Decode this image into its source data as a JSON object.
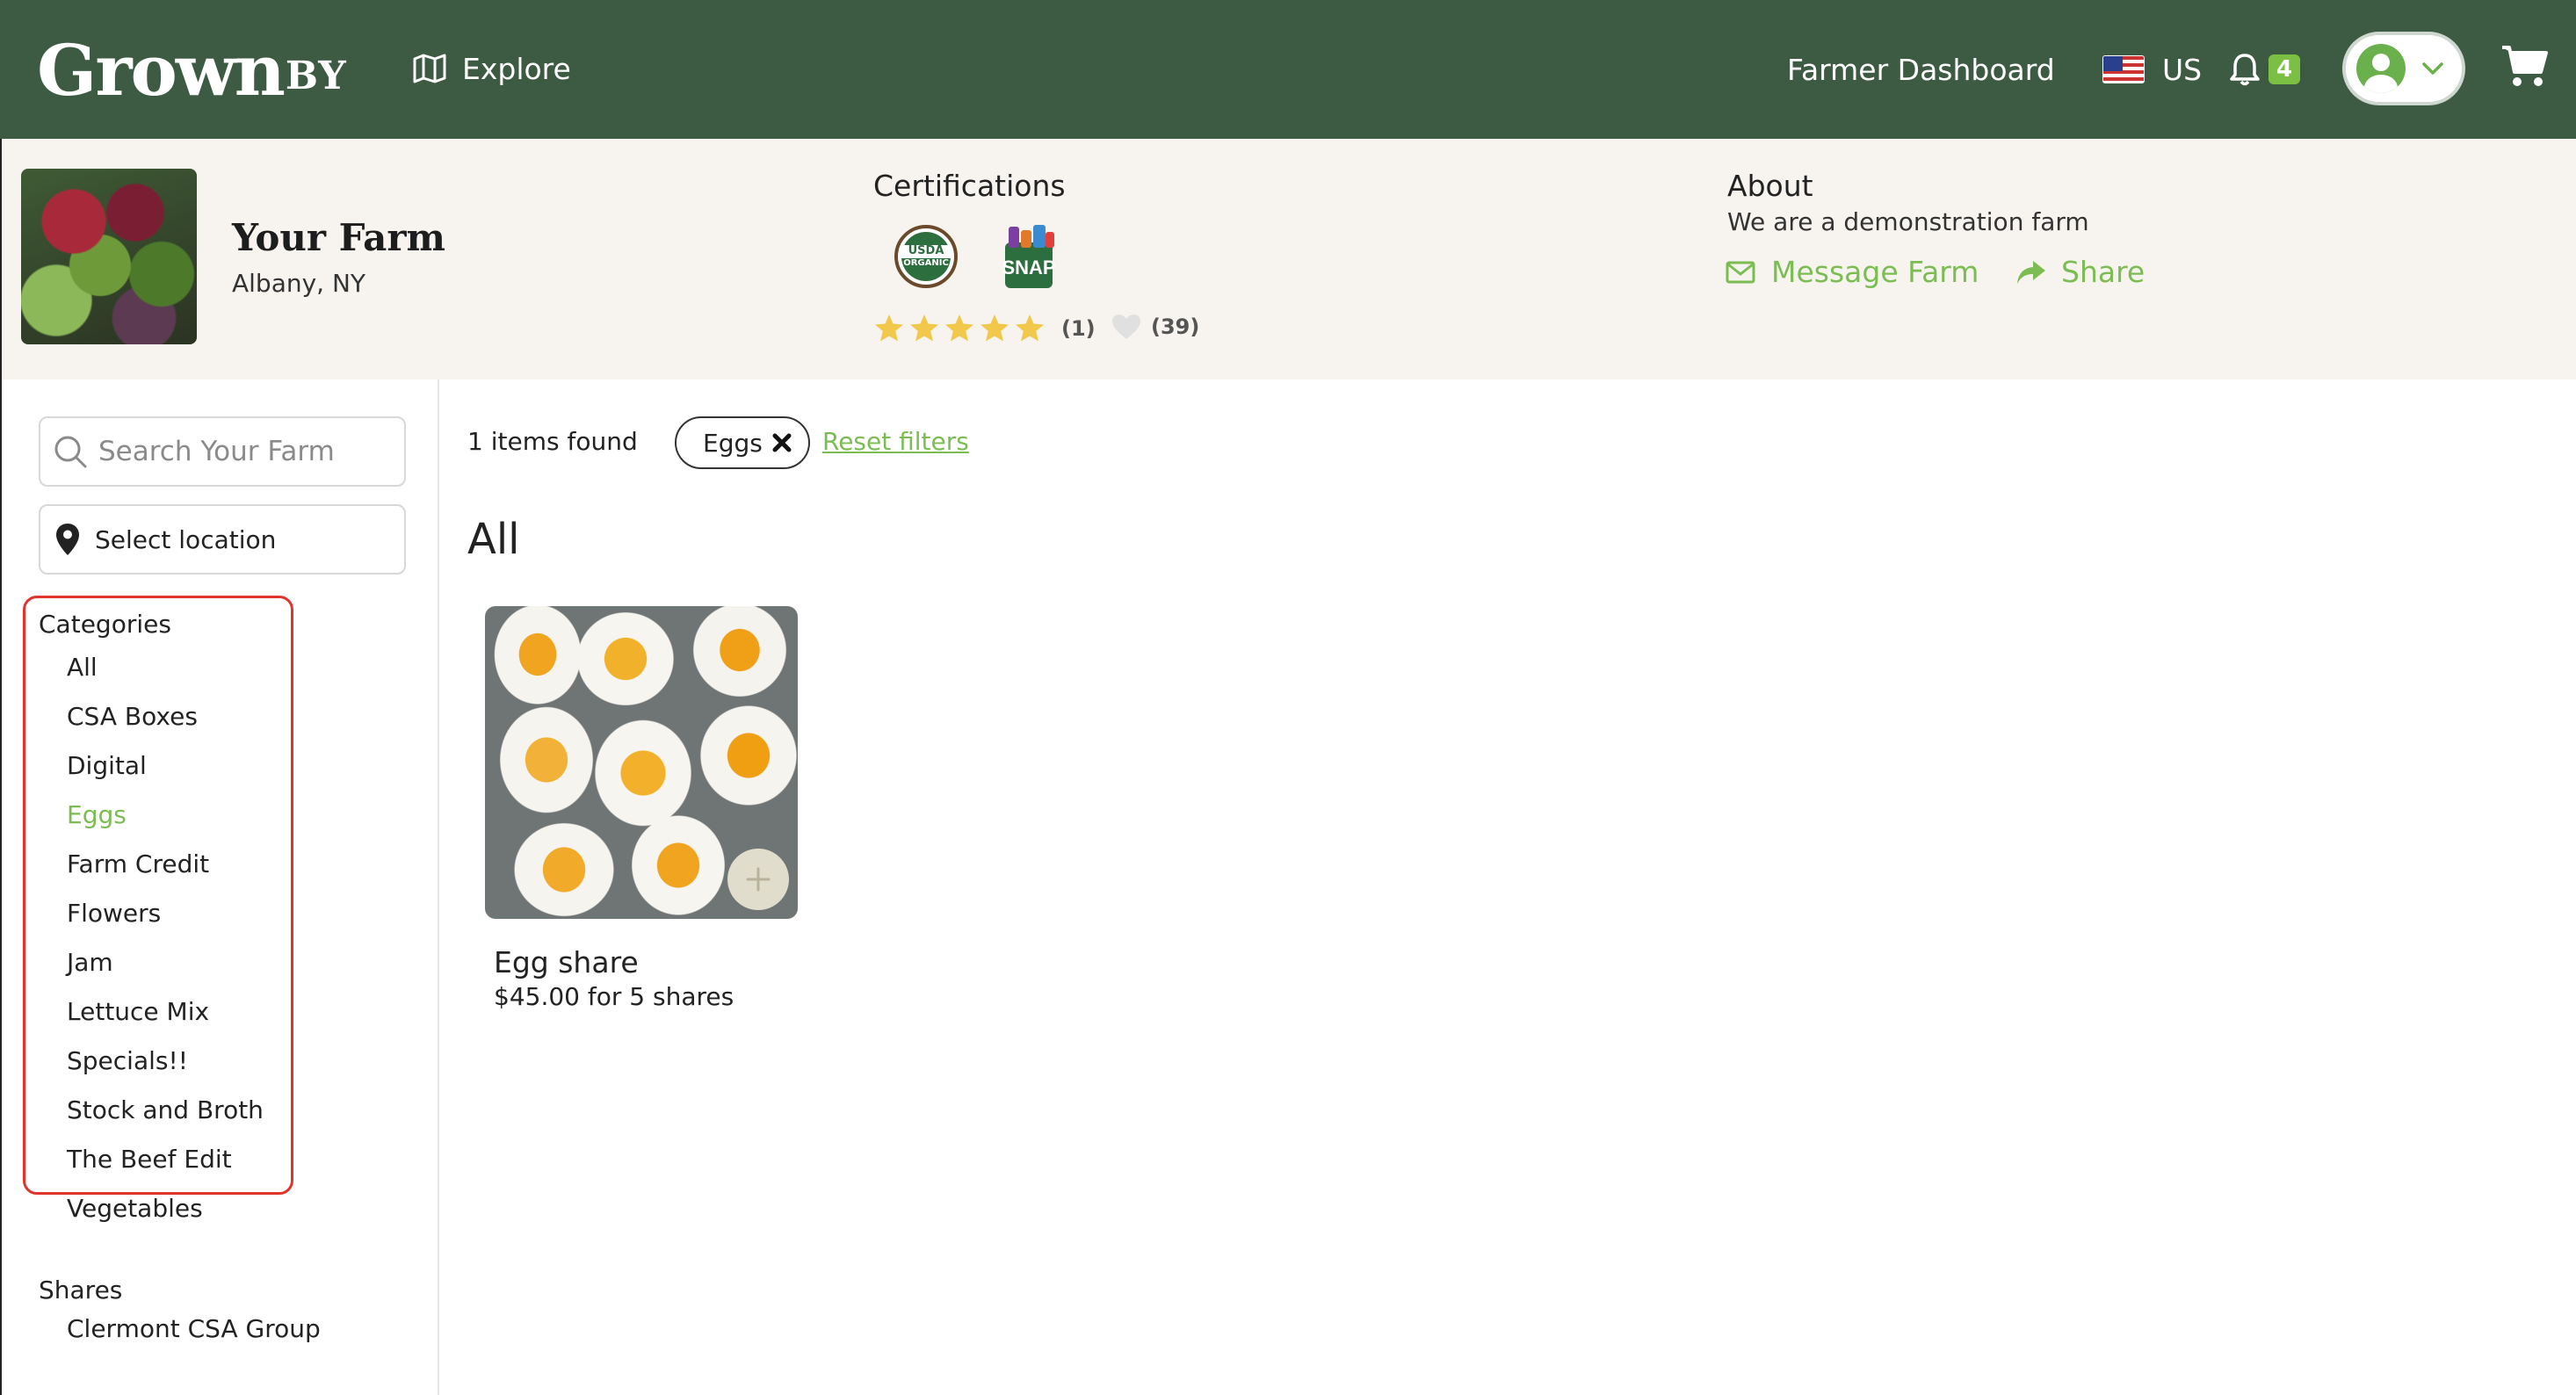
{
  "header": {
    "logo_word": "Grown",
    "logo_by": "BY",
    "explore_label": "Explore",
    "farmer_dashboard_label": "Farmer Dashboard",
    "country_label": "US",
    "notification_count": "4",
    "icons": [
      "map-icon",
      "flag-us-icon",
      "bell-icon",
      "user-avatar-icon",
      "chevron-down-icon",
      "cart-icon"
    ],
    "colors": {
      "bar": "#3d5b43",
      "badge": "#7bc043"
    }
  },
  "farm": {
    "name": "Your Farm",
    "location": "Albany, NY",
    "certifications_title": "Certifications",
    "cert_usda_top": "USDA",
    "cert_usda_bottom": "ORGANIC",
    "cert_snap": "SNAP",
    "rating_stars": 5,
    "rating_count": "(1)",
    "likes_count": "(39)",
    "about_title": "About",
    "about_text": "We are a demonstration farm",
    "message_label": "Message Farm",
    "share_label": "Share",
    "colors": {
      "band": "#f7f4ef",
      "accent": "#7bbd52",
      "star": "#f2c84b"
    }
  },
  "sidebar": {
    "search_placeholder": "Search Your Farm",
    "location_label": "Select location",
    "categories_title": "Categories",
    "categories": [
      {
        "label": "All",
        "active": false
      },
      {
        "label": "CSA Boxes",
        "active": false
      },
      {
        "label": "Digital",
        "active": false
      },
      {
        "label": "Eggs",
        "active": true
      },
      {
        "label": "Farm Credit",
        "active": false
      },
      {
        "label": "Flowers",
        "active": false
      },
      {
        "label": "Jam",
        "active": false
      },
      {
        "label": "Lettuce Mix",
        "active": false
      },
      {
        "label": "Specials!!",
        "active": false
      },
      {
        "label": "Stock and Broth",
        "active": false
      },
      {
        "label": "The Beef Edit",
        "active": false
      },
      {
        "label": "Vegetables",
        "active": false
      }
    ],
    "shares_title": "Shares",
    "shares": [
      "Clermont CSA Group"
    ],
    "colors": {
      "highlight_border": "#e0352b"
    }
  },
  "main": {
    "items_found": "1 items found",
    "filter_chip": "Eggs",
    "reset_filters": "Reset filters",
    "section_title": "All",
    "products": [
      {
        "name": "Egg share",
        "price": "$45.00 for 5 shares"
      }
    ]
  }
}
